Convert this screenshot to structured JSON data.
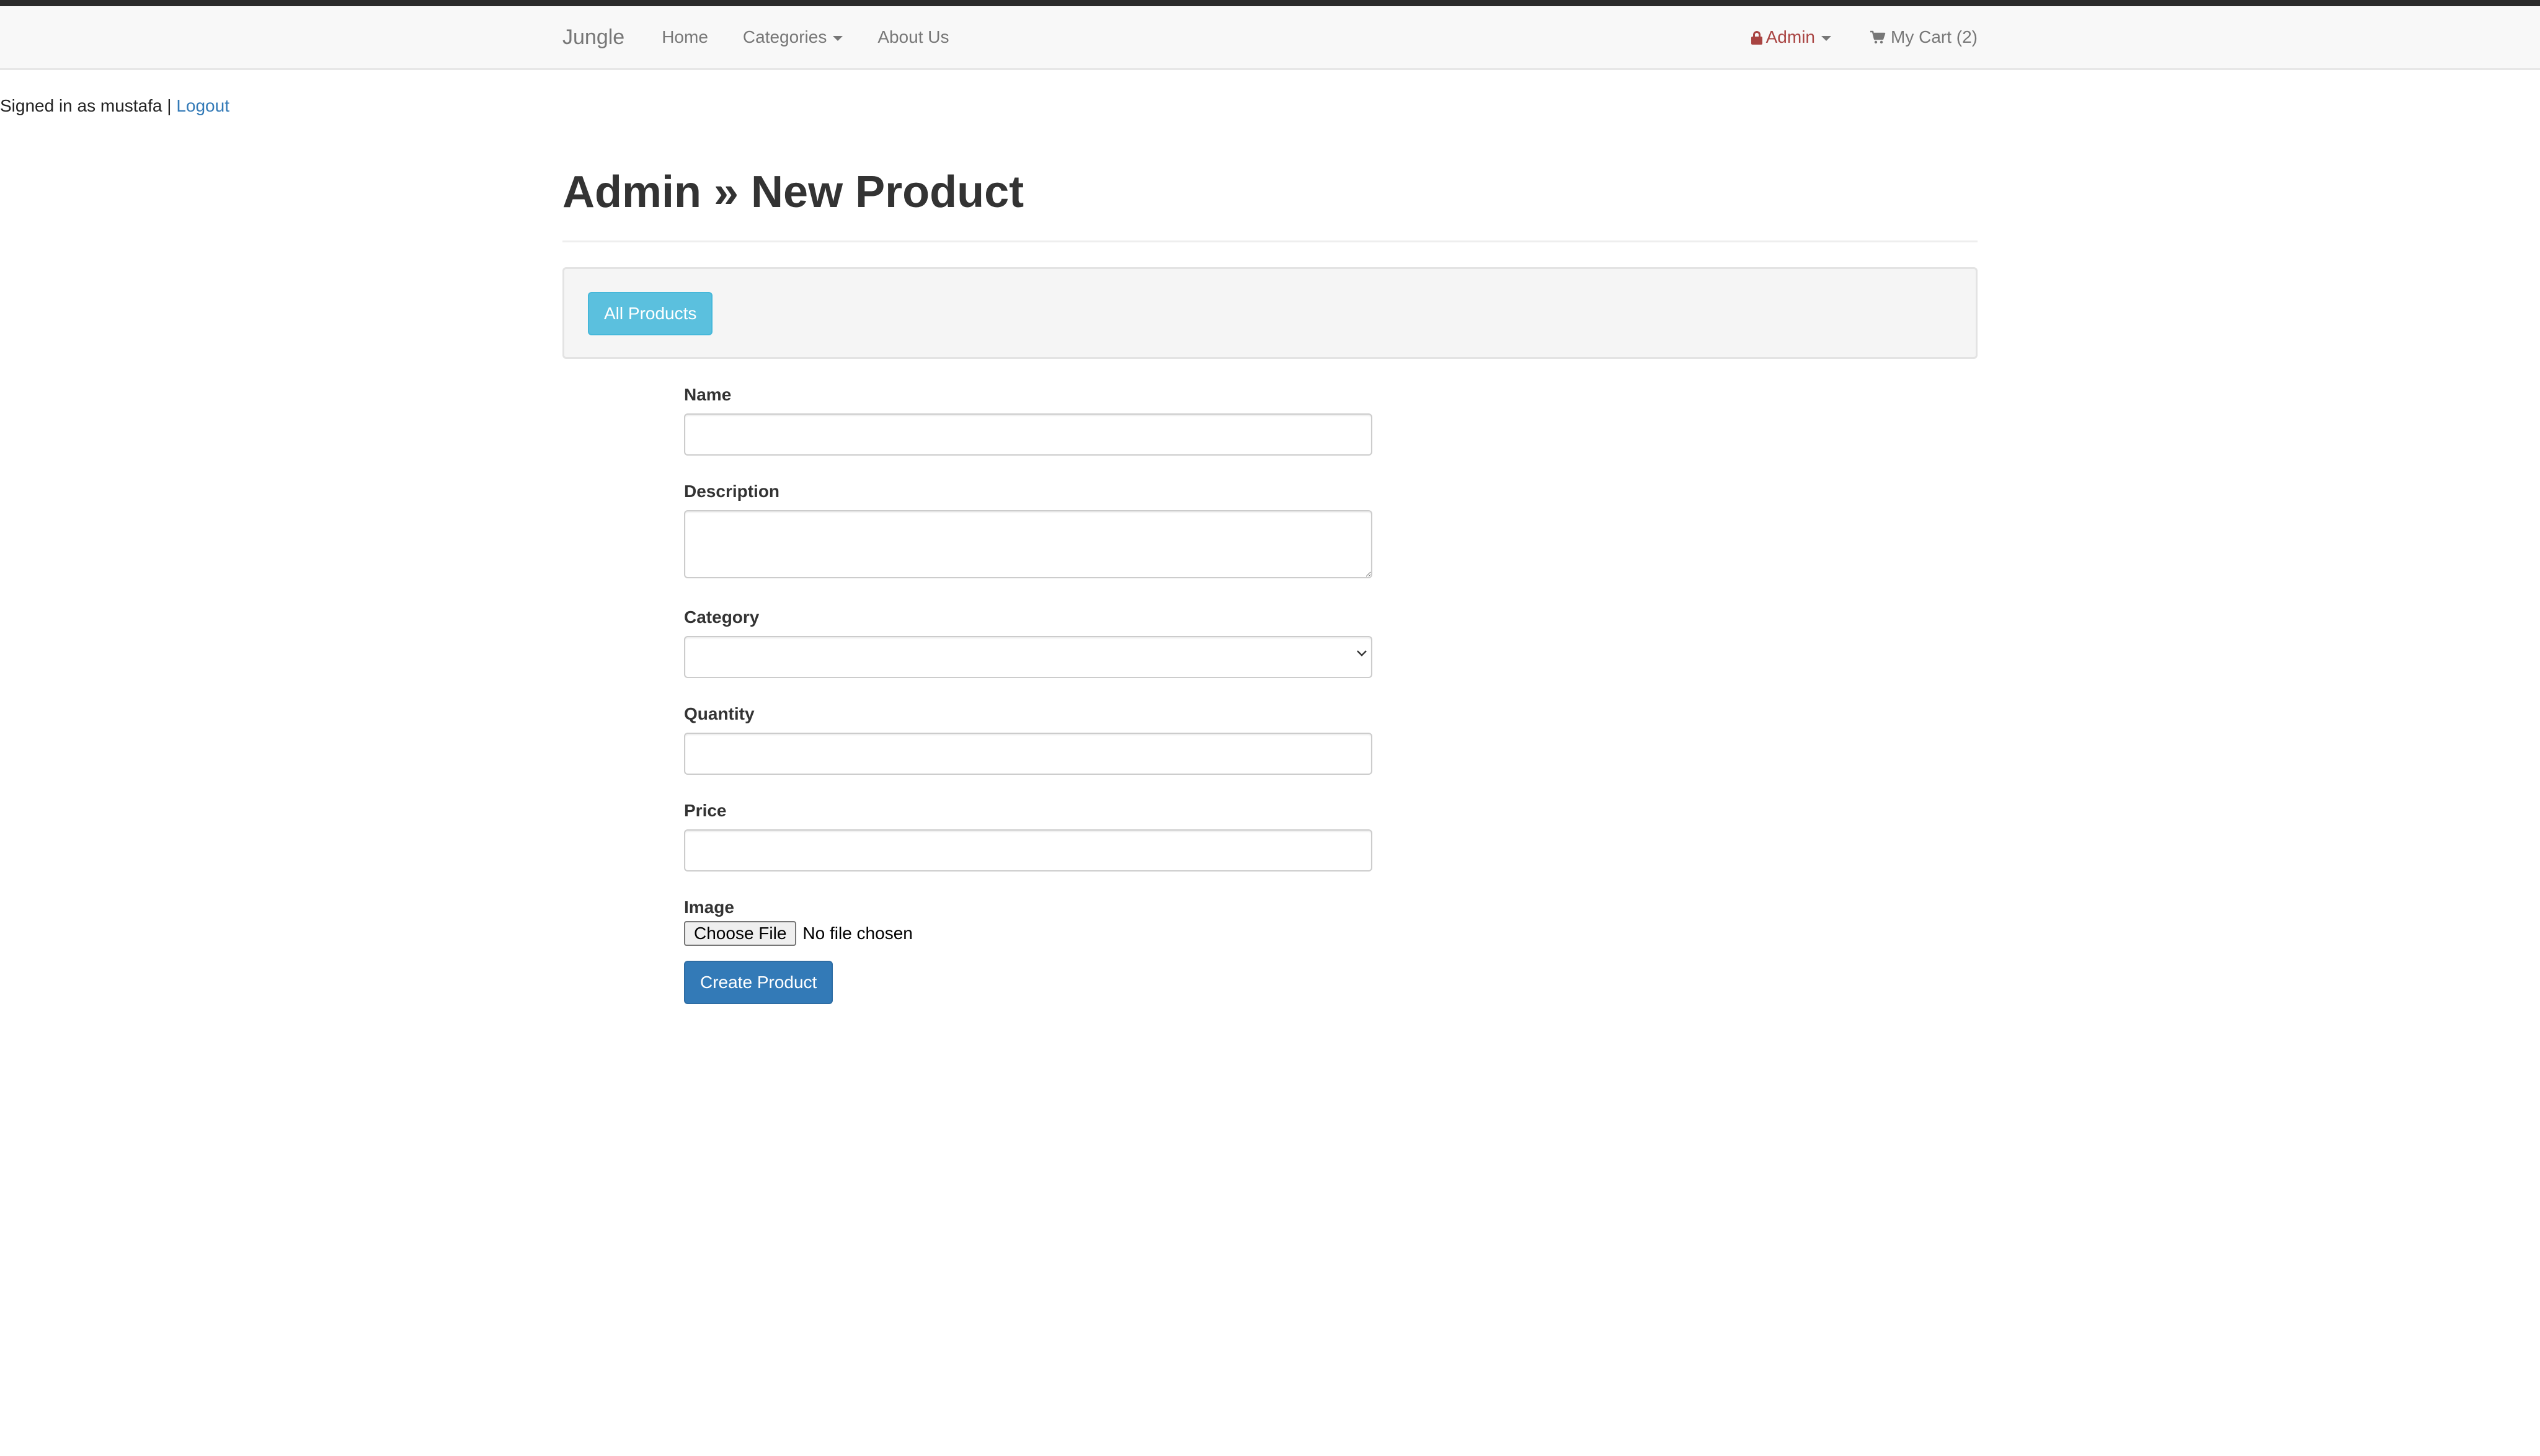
{
  "navbar": {
    "brand": "Jungle",
    "home": "Home",
    "categories": "Categories",
    "about": "About Us",
    "admin": "Admin",
    "cart": "My Cart (2)"
  },
  "session": {
    "signed_in_text": "Signed in as mustafa |",
    "logout": "Logout"
  },
  "page": {
    "title": "Admin » New Product",
    "all_products_button": "All Products"
  },
  "form": {
    "name_label": "Name",
    "name_value": "",
    "description_label": "Description",
    "description_value": "",
    "category_label": "Category",
    "category_value": "",
    "quantity_label": "Quantity",
    "quantity_value": "",
    "price_label": "Price",
    "price_value": "",
    "image_label": "Image",
    "choose_file": "Choose File",
    "no_file": "No file chosen",
    "submit": "Create Product"
  },
  "colors": {
    "admin_accent": "#a94442",
    "info_button": "#5bc0de",
    "primary_button": "#337ab7",
    "link": "#337ab7"
  },
  "icons": {
    "admin": "lock-icon",
    "cart": "shopping-cart-icon",
    "dropdown": "caret-down-icon"
  }
}
